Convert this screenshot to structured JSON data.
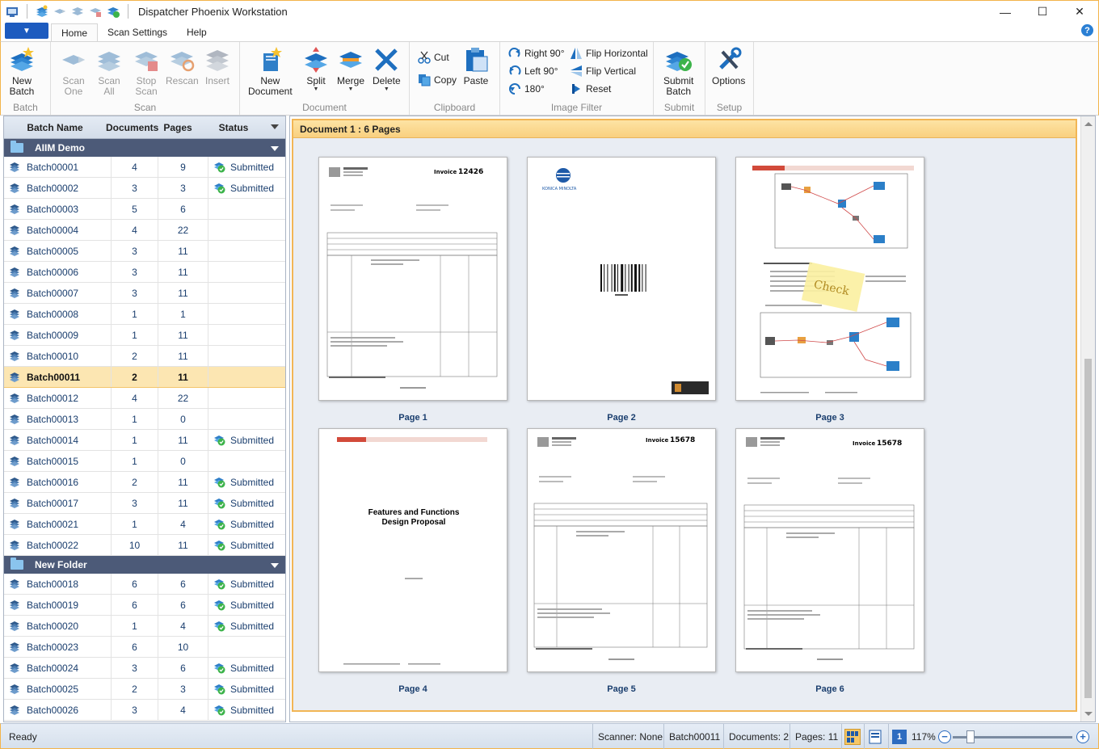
{
  "window": {
    "title": "Dispatcher Phoenix Workstation",
    "minimize": "—",
    "maximize": "☐",
    "close": "✕"
  },
  "ribbon": {
    "file_caret": "▼",
    "tabs": [
      {
        "label": "Home",
        "active": true
      },
      {
        "label": "Scan Settings",
        "active": false
      },
      {
        "label": "Help",
        "active": false
      }
    ],
    "help_icon": "?",
    "groups": {
      "batch": {
        "label": "Batch",
        "new_batch_l1": "New",
        "new_batch_l2": "Batch"
      },
      "scan": {
        "label": "Scan",
        "scan_one_l1": "Scan",
        "scan_one_l2": "One",
        "scan_all_l1": "Scan",
        "scan_all_l2": "All",
        "stop_scan_l1": "Stop",
        "stop_scan_l2": "Scan",
        "rescan": "Rescan",
        "insert": "Insert"
      },
      "document": {
        "label": "Document",
        "new_doc_l1": "New",
        "new_doc_l2": "Document",
        "split": "Split",
        "merge": "Merge",
        "delete": "Delete"
      },
      "clipboard": {
        "label": "Clipboard",
        "cut": "Cut",
        "copy": "Copy",
        "paste": "Paste"
      },
      "image_filter": {
        "label": "Image Filter",
        "right90": "Right 90°",
        "left90": "Left 90°",
        "r180": "180°",
        "flip_h": "Flip Horizontal",
        "flip_v": "Flip Vertical",
        "reset": "Reset"
      },
      "submit": {
        "label": "Submit",
        "submit_l1": "Submit",
        "submit_l2": "Batch"
      },
      "setup": {
        "label": "Setup",
        "options": "Options"
      }
    }
  },
  "batch_grid": {
    "columns": {
      "name": "Batch Name",
      "documents": "Documents",
      "pages": "Pages",
      "status": "Status"
    },
    "folders": [
      {
        "name": "AIIM Demo",
        "rows": [
          {
            "name": "Batch00001",
            "docs": "4",
            "pages": "9",
            "status": "Submitted"
          },
          {
            "name": "Batch00002",
            "docs": "3",
            "pages": "3",
            "status": "Submitted"
          },
          {
            "name": "Batch00003",
            "docs": "5",
            "pages": "6",
            "status": ""
          },
          {
            "name": "Batch00004",
            "docs": "4",
            "pages": "22",
            "status": ""
          },
          {
            "name": "Batch00005",
            "docs": "3",
            "pages": "11",
            "status": ""
          },
          {
            "name": "Batch00006",
            "docs": "3",
            "pages": "11",
            "status": ""
          },
          {
            "name": "Batch00007",
            "docs": "3",
            "pages": "11",
            "status": ""
          },
          {
            "name": "Batch00008",
            "docs": "1",
            "pages": "1",
            "status": ""
          },
          {
            "name": "Batch00009",
            "docs": "1",
            "pages": "11",
            "status": ""
          },
          {
            "name": "Batch00010",
            "docs": "2",
            "pages": "11",
            "status": ""
          },
          {
            "name": "Batch00011",
            "docs": "2",
            "pages": "11",
            "status": "",
            "selected": true
          },
          {
            "name": "Batch00012",
            "docs": "4",
            "pages": "22",
            "status": ""
          },
          {
            "name": "Batch00013",
            "docs": "1",
            "pages": "0",
            "status": ""
          },
          {
            "name": "Batch00014",
            "docs": "1",
            "pages": "11",
            "status": "Submitted"
          },
          {
            "name": "Batch00015",
            "docs": "1",
            "pages": "0",
            "status": ""
          },
          {
            "name": "Batch00016",
            "docs": "2",
            "pages": "11",
            "status": "Submitted"
          },
          {
            "name": "Batch00017",
            "docs": "3",
            "pages": "11",
            "status": "Submitted"
          },
          {
            "name": "Batch00021",
            "docs": "1",
            "pages": "4",
            "status": "Submitted"
          },
          {
            "name": "Batch00022",
            "docs": "10",
            "pages": "11",
            "status": "Submitted"
          }
        ]
      },
      {
        "name": "New Folder",
        "rows": [
          {
            "name": "Batch00018",
            "docs": "6",
            "pages": "6",
            "status": "Submitted"
          },
          {
            "name": "Batch00019",
            "docs": "6",
            "pages": "6",
            "status": "Submitted"
          },
          {
            "name": "Batch00020",
            "docs": "1",
            "pages": "4",
            "status": "Submitted"
          },
          {
            "name": "Batch00023",
            "docs": "6",
            "pages": "10",
            "status": ""
          },
          {
            "name": "Batch00024",
            "docs": "3",
            "pages": "6",
            "status": "Submitted"
          },
          {
            "name": "Batch00025",
            "docs": "2",
            "pages": "3",
            "status": "Submitted"
          },
          {
            "name": "Batch00026",
            "docs": "3",
            "pages": "4",
            "status": "Submitted"
          }
        ]
      }
    ]
  },
  "document_view": {
    "header": "Document 1 : 6 Pages",
    "pages": [
      {
        "label": "Page 1",
        "kind": "invoice",
        "invoice_title": "Invoice",
        "invoice_no": "12426"
      },
      {
        "label": "Page 2",
        "kind": "barcode",
        "brand": "KONICA MINOLTA"
      },
      {
        "label": "Page 3",
        "kind": "diagram",
        "sticky_note": "Check"
      },
      {
        "label": "Page 4",
        "kind": "proposal",
        "title_line1": "Features and Functions",
        "title_line2": "Design Proposal"
      },
      {
        "label": "Page 5",
        "kind": "invoice",
        "invoice_title": "Invoice",
        "invoice_no": "15678"
      },
      {
        "label": "Page 6",
        "kind": "invoice",
        "invoice_title": "Invoice",
        "invoice_no": "15678"
      }
    ]
  },
  "statusbar": {
    "status": "Ready",
    "scanner": "Scanner: None",
    "batch": "Batch00011",
    "documents": "Documents: 2",
    "pages": "Pages: 11",
    "zoom": "117%",
    "zoom_level": 0.15
  },
  "colors": {
    "accent": "#f3b44a",
    "folder_bar": "#4c5a78",
    "selected_row": "#fce6b2",
    "link_text": "#1a3e6e"
  }
}
